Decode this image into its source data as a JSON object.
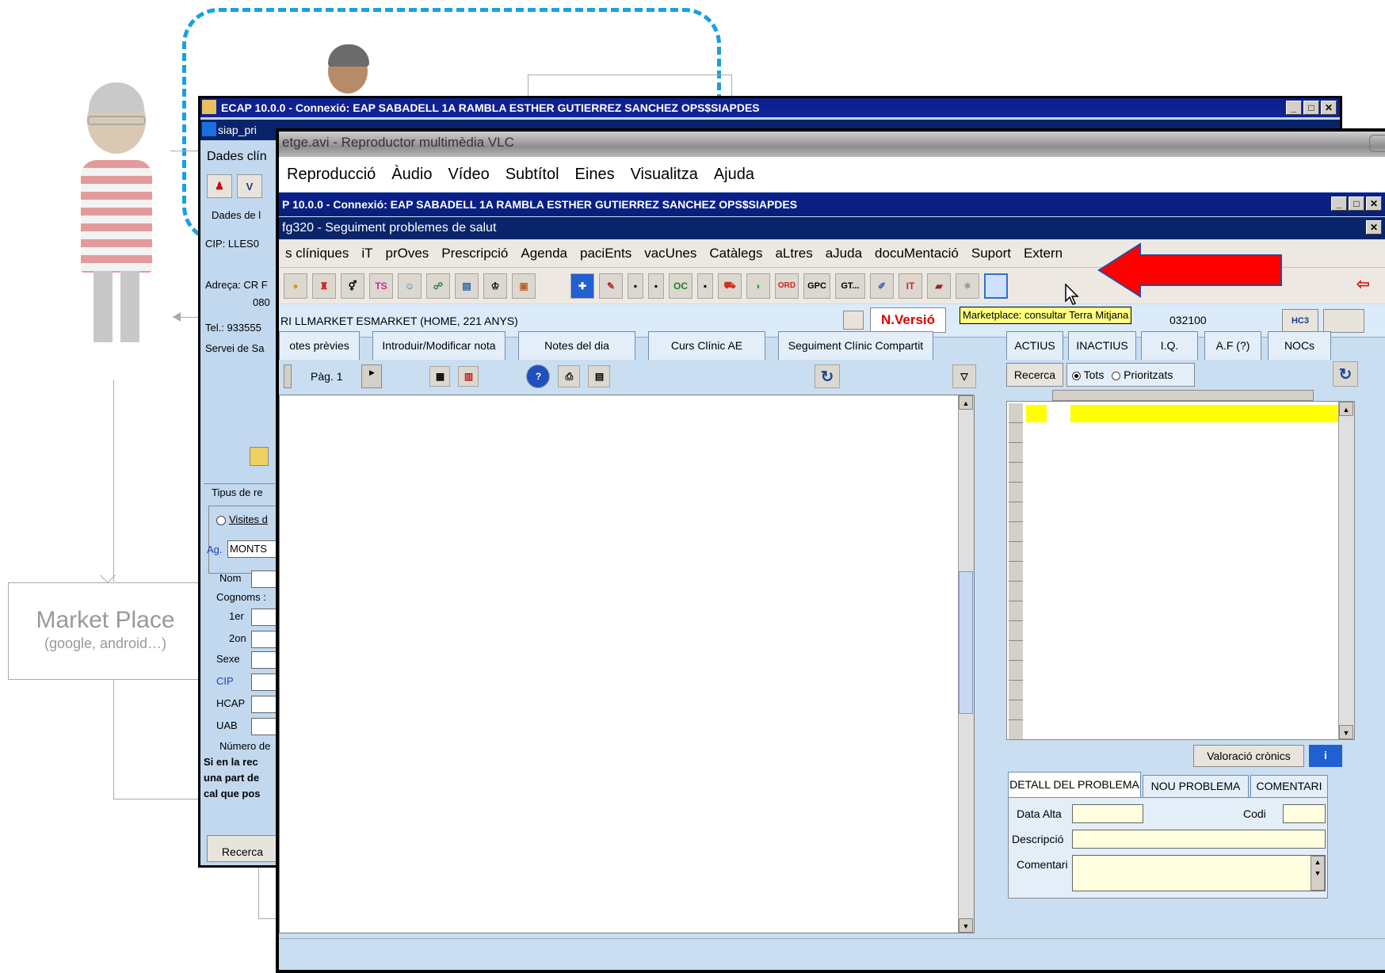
{
  "diagram": {
    "market_place_title": "Market Place",
    "market_place_subtitle": "(google, android…)"
  },
  "back_window": {
    "title": "ECAP 10.0.0 - Connexió: EAP SABADELL 1A RAMBLA ESTHER GUTIERREZ SANCHEZ OPS$SIAPDES",
    "subtitle": "siap_pri",
    "menu_first": "Dades clín",
    "section_patient": "Dades de l",
    "cip_label": "CIP:",
    "cip_value": "LLES0",
    "adreca_label": "Adreça: CR F",
    "adreca_cont": "080",
    "tel_label": "Tel.: 933555",
    "servei_label": "Servei de Sa",
    "tipus_label": "Tipus de re",
    "visites_label": "Visites d",
    "ag_label": "Ag.",
    "ag_value": "MONTS",
    "nom_label": "Nom",
    "cognoms_label": "Cognoms :",
    "primer_label": "1er",
    "segon_label": "2on",
    "sexe_label": "Sexe",
    "cip2_label": "CIP",
    "hcap_label": "HCAP",
    "uab_label": "UAB",
    "numero_label": "Número de",
    "warning_line1": "Si en la rec",
    "warning_line2": "una part de",
    "warning_line3": "cal que pos",
    "recerca_label": "Recerca"
  },
  "vlc": {
    "title": "etge.avi - Reproductor multimèdia VLC",
    "menu": [
      "Reproducció",
      "Àudio",
      "Vídeo",
      "Subtítol",
      "Eines",
      "Visualitza",
      "Ajuda"
    ]
  },
  "ecap": {
    "title": "P 10.0.0 - Connexió: EAP SABADELL 1A RAMBLA ESTHER GUTIERREZ SANCHEZ OPS$SIAPDES",
    "subtitle": "fg320 - Seguiment problemes de salut",
    "menu": [
      "s clíniques",
      "iT",
      "prOves",
      "Prescripció",
      "Agenda",
      "paciEnts",
      "vacUnes",
      "Catàlegs",
      "aLtres",
      "aJuda",
      "docuMentació",
      "Suport",
      "Extern"
    ],
    "toolbar": {
      "ts": "TS",
      "oc": "OC",
      "ord": "ORD",
      "gpc": "GPC",
      "gt": "GT...",
      "it": "IT"
    },
    "patient": "RI LLMARKET ESMARKET  (HOME, 221 ANYS)",
    "nversio": "N.Versió",
    "tooltip": "Marketplace: consultar Terra Mitjana",
    "code": "032100",
    "hc3": "HC3",
    "tabs": [
      "otes prèvies",
      "Introduir/Modificar nota",
      "Notes del dia",
      "Curs Clínic AE",
      "Seguiment Clínic Compartit"
    ],
    "page_label": "Pàg. 1",
    "right_tabs": [
      "ACTIUS",
      "INACTIUS",
      "I.Q.",
      "A.F (?)",
      "NOCs"
    ],
    "recerca": "Recerca",
    "tots": "Tots",
    "prioritzats": "Prioritzats",
    "valoracio": "Valoració crònics",
    "info": "i",
    "detail_tabs": [
      "DETALL DEL PROBLEMA",
      "NOU PROBLEMA",
      "COMENTARI"
    ],
    "data_alta": "Data Alta",
    "codi": "Codi",
    "descripcio": "Descripció",
    "comentari": "Comentari"
  },
  "colors": {
    "dashed_border": "#1aa0e0",
    "title_bar": "#0a246a",
    "panel_bg": "#c9def1",
    "nversio_text": "#e00000",
    "highlight": "#ffff00",
    "arrow": "#ff0000"
  }
}
